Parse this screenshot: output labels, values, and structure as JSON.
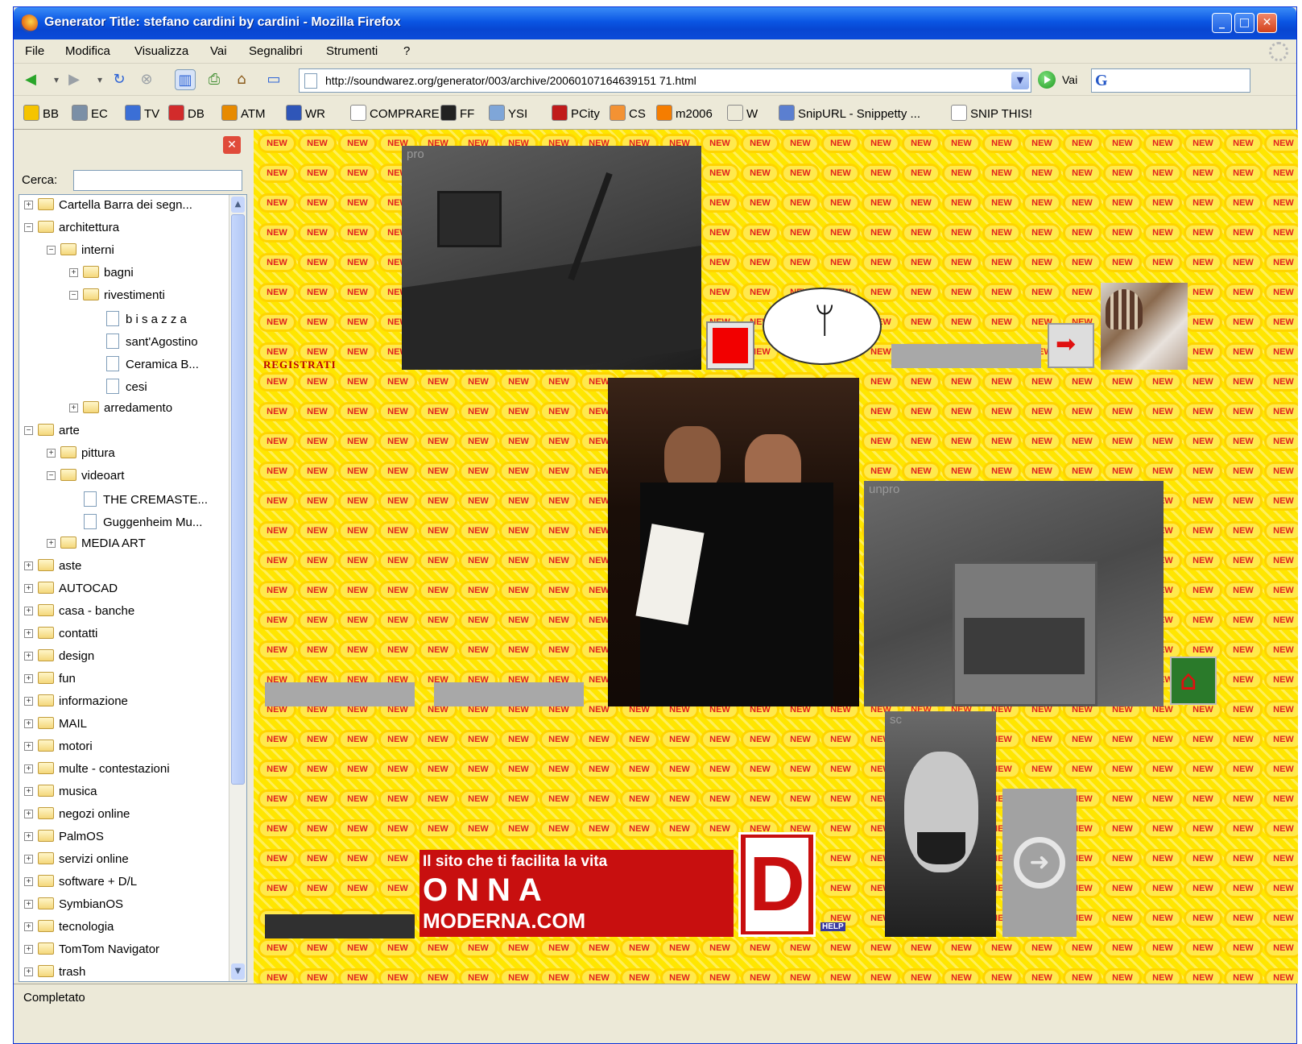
{
  "window": {
    "title": "Generator Title: stefano cardini by cardini - Mozilla Firefox",
    "controls": {
      "minimize": "_",
      "maximize": "□",
      "close": "✕"
    }
  },
  "menu": [
    "File",
    "Modifica",
    "Visualizza",
    "Vai",
    "Segnalibri",
    "Strumenti",
    "?"
  ],
  "nav": {
    "url": "http://soundwarez.org/generator/003/archive/20060107164639151 71.html",
    "go_label": "Vai",
    "search_engine_glyph": "G"
  },
  "bookmarks": [
    {
      "label": "BB",
      "icon": "yellow-face-icon",
      "color": "#f5c400"
    },
    {
      "label": "EC",
      "icon": "ec-icon",
      "color": "#7b8fa6"
    },
    {
      "label": "TV",
      "icon": "google-icon",
      "color": "#3b6fd6"
    },
    {
      "label": "DB",
      "icon": "db-icon",
      "color": "#d22b2b"
    },
    {
      "label": "ATM",
      "icon": "atm-icon",
      "color": "#e78a00"
    },
    {
      "label": "WR",
      "icon": "wr-icon",
      "color": "#2f56b8"
    },
    {
      "label": "COMPRARE",
      "icon": "page-icon",
      "color": "#ffffff"
    },
    {
      "label": "FF",
      "icon": "ff-icon",
      "color": "#222222"
    },
    {
      "label": "YSI",
      "icon": "ysi-icon",
      "color": "#7fa6d8"
    },
    {
      "label": "PCity",
      "icon": "pcity-icon",
      "color": "#c01b1b"
    },
    {
      "label": "CS",
      "icon": "rss-icon",
      "color": "#f39233"
    },
    {
      "label": "m2006",
      "icon": "blogger-icon",
      "color": "#f57d00"
    },
    {
      "label": "W",
      "icon": "wikipedia-icon",
      "color": "#ece9d8"
    },
    {
      "label": "SnipURL - Snippetty ...",
      "icon": "snipurl-icon",
      "color": "#5b7fd0"
    },
    {
      "label": "SNIP THIS!",
      "icon": "page-icon",
      "color": "#ffffff"
    }
  ],
  "sidebar": {
    "search_label": "Cerca:",
    "search_value": "",
    "tree": [
      {
        "label": "Cartella Barra dei segn...",
        "level": 0,
        "type": "folder",
        "expander": "+"
      },
      {
        "label": "architettura",
        "level": 0,
        "type": "folder",
        "expander": "−"
      },
      {
        "label": "interni",
        "level": 1,
        "type": "folder",
        "expander": "−"
      },
      {
        "label": "bagni",
        "level": 2,
        "type": "folder",
        "expander": "+"
      },
      {
        "label": "rivestimenti",
        "level": 2,
        "type": "folder",
        "expander": "−"
      },
      {
        "label": "b i s a z z a",
        "level": 3,
        "type": "page"
      },
      {
        "label": "sant'Agostino",
        "level": 3,
        "type": "page"
      },
      {
        "label": "Ceramica B...",
        "level": 3,
        "type": "page"
      },
      {
        "label": "cesi",
        "level": 3,
        "type": "page"
      },
      {
        "label": "arredamento",
        "level": 2,
        "type": "folder",
        "expander": "+"
      },
      {
        "label": "arte",
        "level": 0,
        "type": "folder",
        "expander": "−"
      },
      {
        "label": "pittura",
        "level": 1,
        "type": "folder",
        "expander": "+"
      },
      {
        "label": "videoart",
        "level": 1,
        "type": "folder",
        "expander": "−"
      },
      {
        "label": "THE CREMASTE...",
        "level": 2,
        "type": "page"
      },
      {
        "label": "Guggenheim Mu...",
        "level": 2,
        "type": "page"
      },
      {
        "label": "MEDIA ART",
        "level": 1,
        "type": "folder",
        "expander": "+"
      },
      {
        "label": "aste",
        "level": 0,
        "type": "folder",
        "expander": "+"
      },
      {
        "label": "AUTOCAD",
        "level": 0,
        "type": "folder",
        "expander": "+"
      },
      {
        "label": "casa - banche",
        "level": 0,
        "type": "folder",
        "expander": "+"
      },
      {
        "label": "contatti",
        "level": 0,
        "type": "folder",
        "expander": "+"
      },
      {
        "label": "design",
        "level": 0,
        "type": "folder",
        "expander": "+"
      },
      {
        "label": "fun",
        "level": 0,
        "type": "folder",
        "expander": "+"
      },
      {
        "label": "informazione",
        "level": 0,
        "type": "folder",
        "expander": "+"
      },
      {
        "label": "MAIL",
        "level": 0,
        "type": "folder",
        "expander": "+"
      },
      {
        "label": "motori",
        "level": 0,
        "type": "folder",
        "expander": "+"
      },
      {
        "label": "multe - contestazioni",
        "level": 0,
        "type": "folder",
        "expander": "+"
      },
      {
        "label": "musica",
        "level": 0,
        "type": "folder",
        "expander": "+"
      },
      {
        "label": "negozi online",
        "level": 0,
        "type": "folder",
        "expander": "+"
      },
      {
        "label": "PalmOS",
        "level": 0,
        "type": "folder",
        "expander": "+"
      },
      {
        "label": "servizi online",
        "level": 0,
        "type": "folder",
        "expander": "+"
      },
      {
        "label": "software + D/L",
        "level": 0,
        "type": "folder",
        "expander": "+"
      },
      {
        "label": "SymbianOS",
        "level": 0,
        "type": "folder",
        "expander": "+"
      },
      {
        "label": "tecnologia",
        "level": 0,
        "type": "folder",
        "expander": "+"
      },
      {
        "label": "TomTom Navigator",
        "level": 0,
        "type": "folder",
        "expander": "+"
      },
      {
        "label": "trash",
        "level": 0,
        "type": "folder",
        "expander": "+"
      }
    ]
  },
  "content": {
    "tile_text": "NEW",
    "pro_label": "pro",
    "unpro_label": "unpro",
    "sc_label": "sc",
    "registrati": "REGISTRATI",
    "banner_tagline": "Il sito che ti facilita la vita",
    "banner_big": "ONNA",
    "banner_small": "MODERNA.COM",
    "banner_letter": "D",
    "help_label": "HELP"
  },
  "status": "Completato"
}
